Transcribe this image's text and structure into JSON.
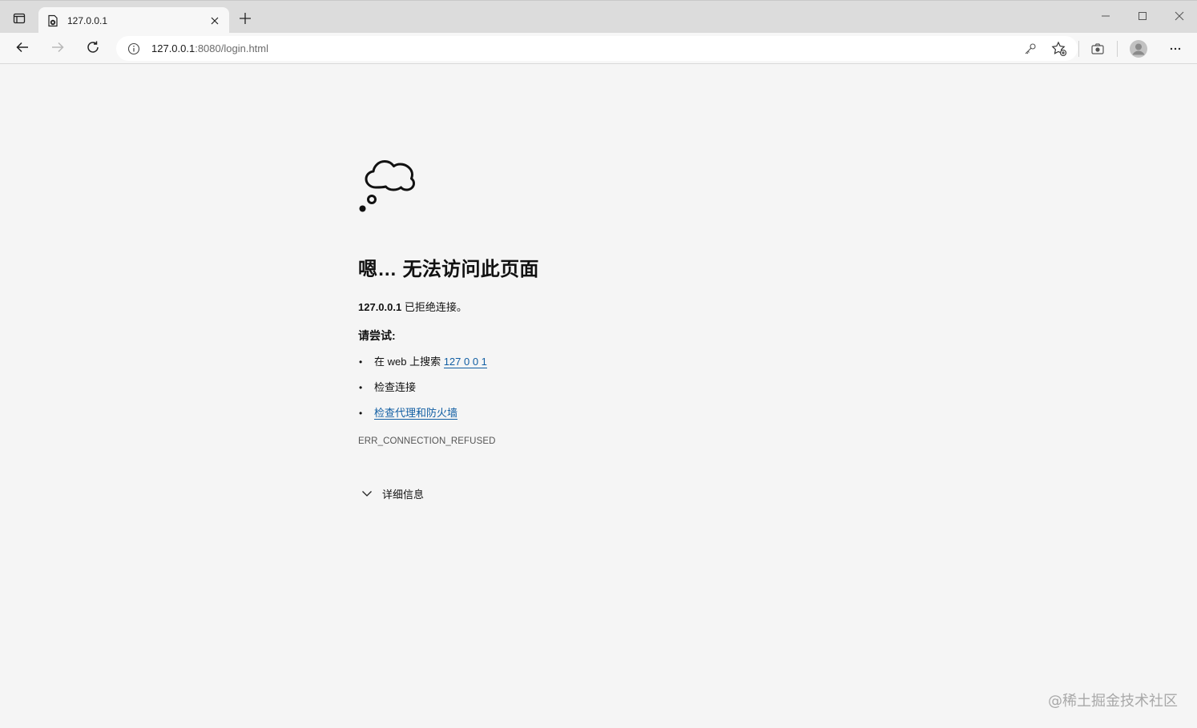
{
  "tab": {
    "title": "127.0.0.1"
  },
  "address_bar": {
    "host": "127.0.0.1",
    "rest": ":8080/login.html"
  },
  "error": {
    "title": "嗯… 无法访问此页面",
    "host_bold": "127.0.0.1",
    "desc_suffix": " 已拒绝连接。",
    "try_label": "请尝试:",
    "suggestions": {
      "search_prefix": "在 web 上搜索 ",
      "search_link": "127 0 0 1",
      "check_connection": "检查连接",
      "check_proxy_link": "检查代理和防火墙"
    },
    "code": "ERR_CONNECTION_REFUSED",
    "details_label": "详细信息"
  },
  "watermark": "@稀土掘金技术社区",
  "icons": {
    "tab_actions": "tab-actions-icon",
    "favicon": "error-page-icon",
    "close": "close-icon",
    "new_tab": "plus-icon",
    "minimize": "minimize-icon",
    "maximize": "maximize-icon",
    "window_close": "close-icon",
    "back": "back-arrow-icon",
    "forward": "forward-arrow-icon",
    "refresh": "refresh-icon",
    "info": "info-icon",
    "key": "key-icon",
    "favorites": "add-favorite-icon",
    "screenshot": "camera-icon",
    "profile": "profile-avatar-icon",
    "more": "more-icon",
    "chevron": "chevron-down-icon",
    "thought_cloud": "thought-cloud-icon"
  }
}
